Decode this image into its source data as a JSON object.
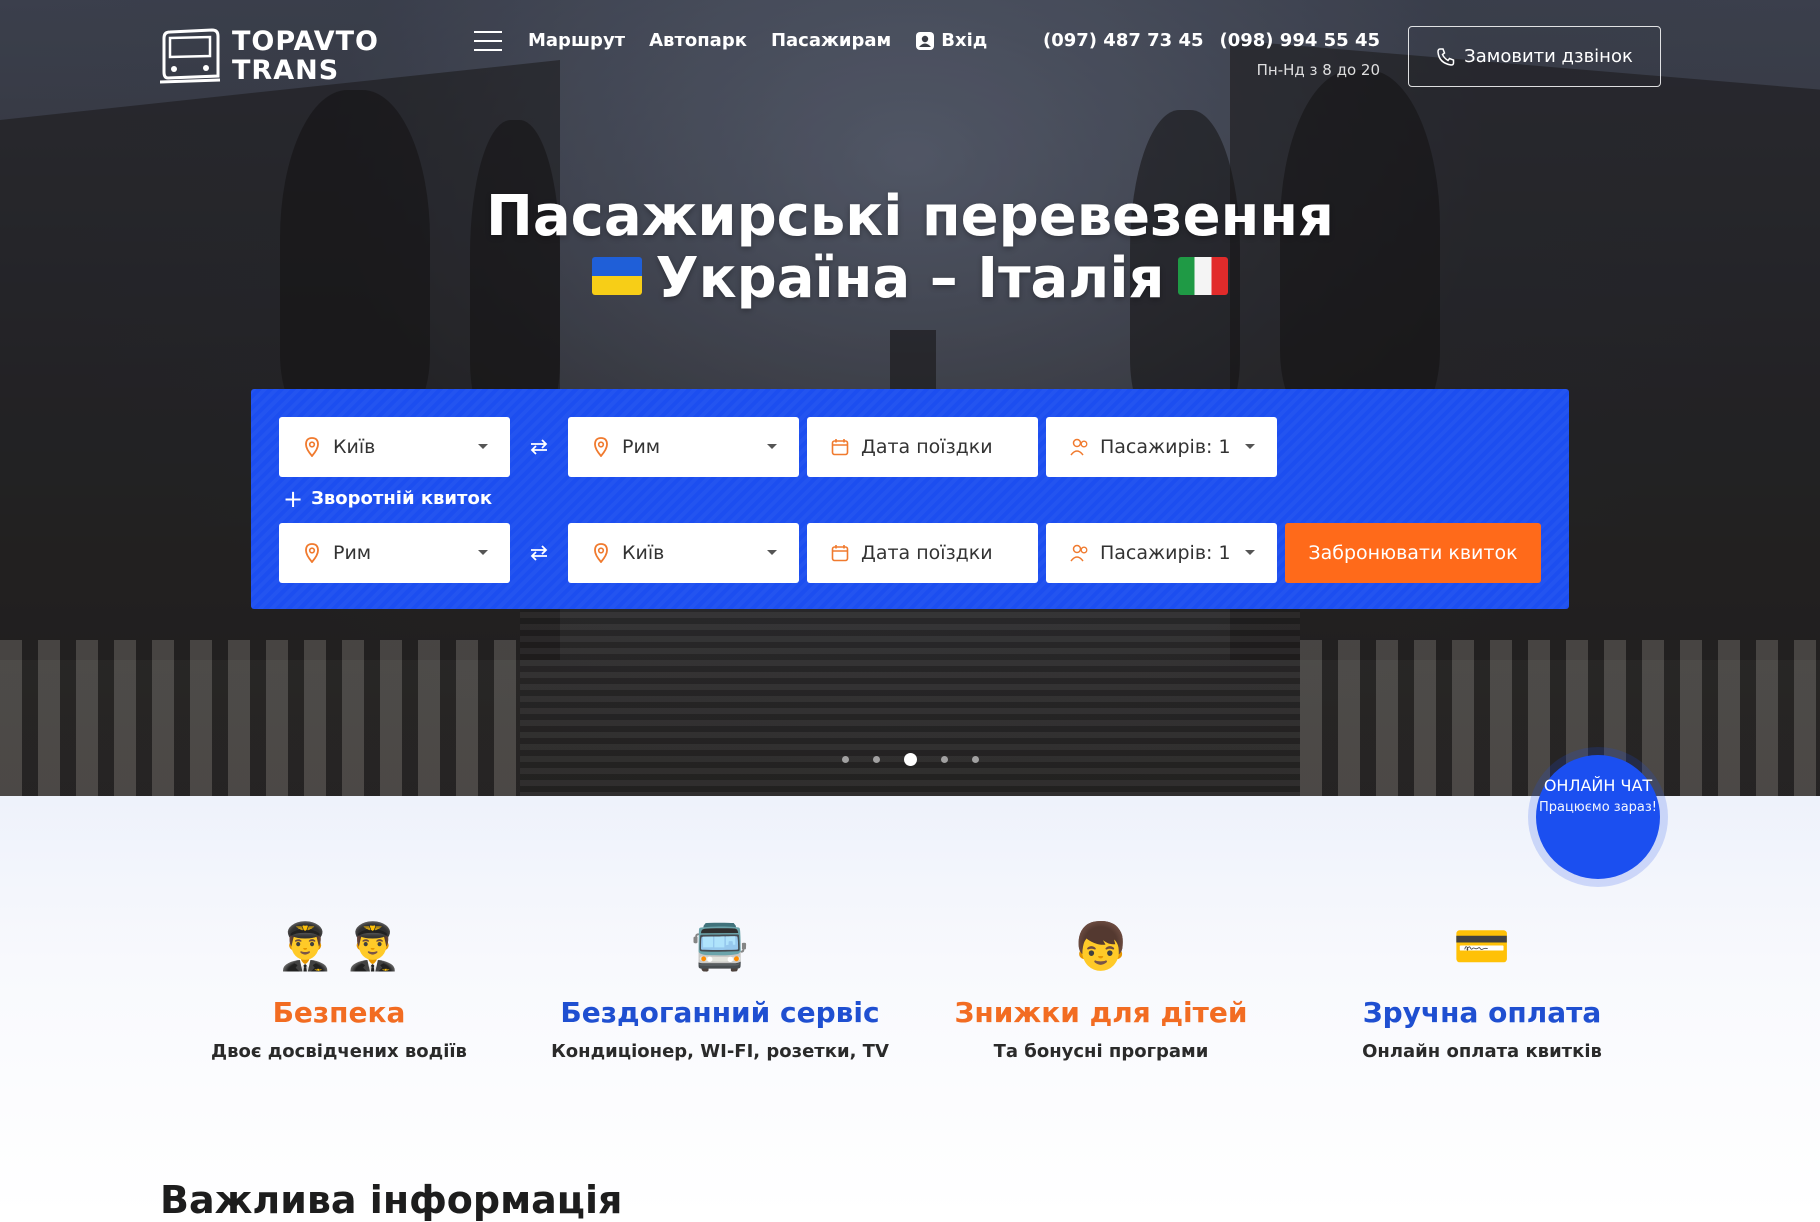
{
  "brand": {
    "line1": "TOPAVTO",
    "line2": "TRANS"
  },
  "nav": {
    "items": [
      "Маршрут",
      "Автопарк",
      "Пасажирам"
    ],
    "login": "Вхід"
  },
  "contacts": {
    "phone1": "(097) 487 73 45",
    "phone2": "(098) 994 55 45",
    "hours": "Пн-Нд з 8 до 20",
    "callback": "Замовити дзвінок"
  },
  "hero": {
    "line1": "Пасажирські перевезення",
    "line2": "Україна – Італія"
  },
  "booking": {
    "outbound": {
      "from": "Київ",
      "to": "Рим",
      "date_placeholder": "Дата поїздки",
      "passengers": "Пасажирів: 1"
    },
    "return_toggle": "Зворотній квиток",
    "return": {
      "from": "Рим",
      "to": "Київ",
      "date_placeholder": "Дата поїздки",
      "passengers": "Пасажирів: 1"
    },
    "submit": "Забронювати квиток"
  },
  "slider": {
    "count": 5,
    "active": 3
  },
  "chat": {
    "title": "ОНЛАЙН ЧАТ",
    "subtitle": "Працюємо зараз!"
  },
  "features": [
    {
      "title": "Безпека",
      "subtitle": "Двоє досвідчених водіїв",
      "icons": [
        "pilot-icon",
        "pilot-icon"
      ]
    },
    {
      "title": "Бездоганний сервіс",
      "subtitle": "Кондиціонер, WI-FI, розетки, TV",
      "icons": [
        "bus-icon"
      ]
    },
    {
      "title": "Знижки для дітей",
      "subtitle": "Та бонусні програми",
      "icons": [
        "child-icon"
      ]
    },
    {
      "title": "Зручна оплата",
      "subtitle": "Онлайн оплата квитків",
      "icons": [
        "credit-card-icon"
      ]
    }
  ],
  "section": {
    "title": "Важлива інформація"
  },
  "colors": {
    "primary": "#1c4ef0",
    "accent": "#ff6a1a",
    "feature_orange": "#f26c22",
    "feature_blue": "#1f4fd1"
  }
}
